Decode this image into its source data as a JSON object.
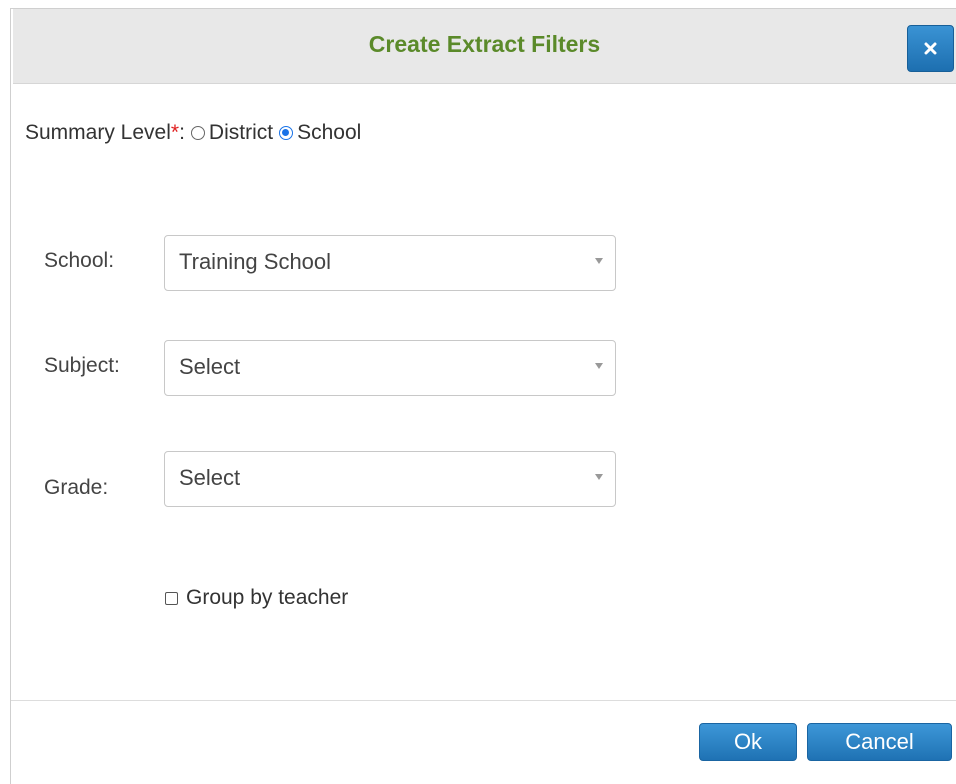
{
  "dialog": {
    "title": "Create Extract Filters",
    "close_icon": "close-icon"
  },
  "summary_level": {
    "label": "Summary Level",
    "required_mark": "*",
    "separator": ":",
    "options": [
      {
        "label": "District",
        "checked": false
      },
      {
        "label": "School",
        "checked": true
      }
    ]
  },
  "fields": {
    "school": {
      "label": "School:",
      "value": "Training School"
    },
    "subject": {
      "label": "Subject:",
      "value": "Select"
    },
    "grade": {
      "label": "Grade:",
      "value": "Select"
    }
  },
  "group_by_teacher": {
    "label": "Group by teacher",
    "checked": false
  },
  "buttons": {
    "ok": "Ok",
    "cancel": "Cancel"
  },
  "colors": {
    "title": "#5b8a2a",
    "button": "#1f72b4",
    "required": "#e02020"
  }
}
